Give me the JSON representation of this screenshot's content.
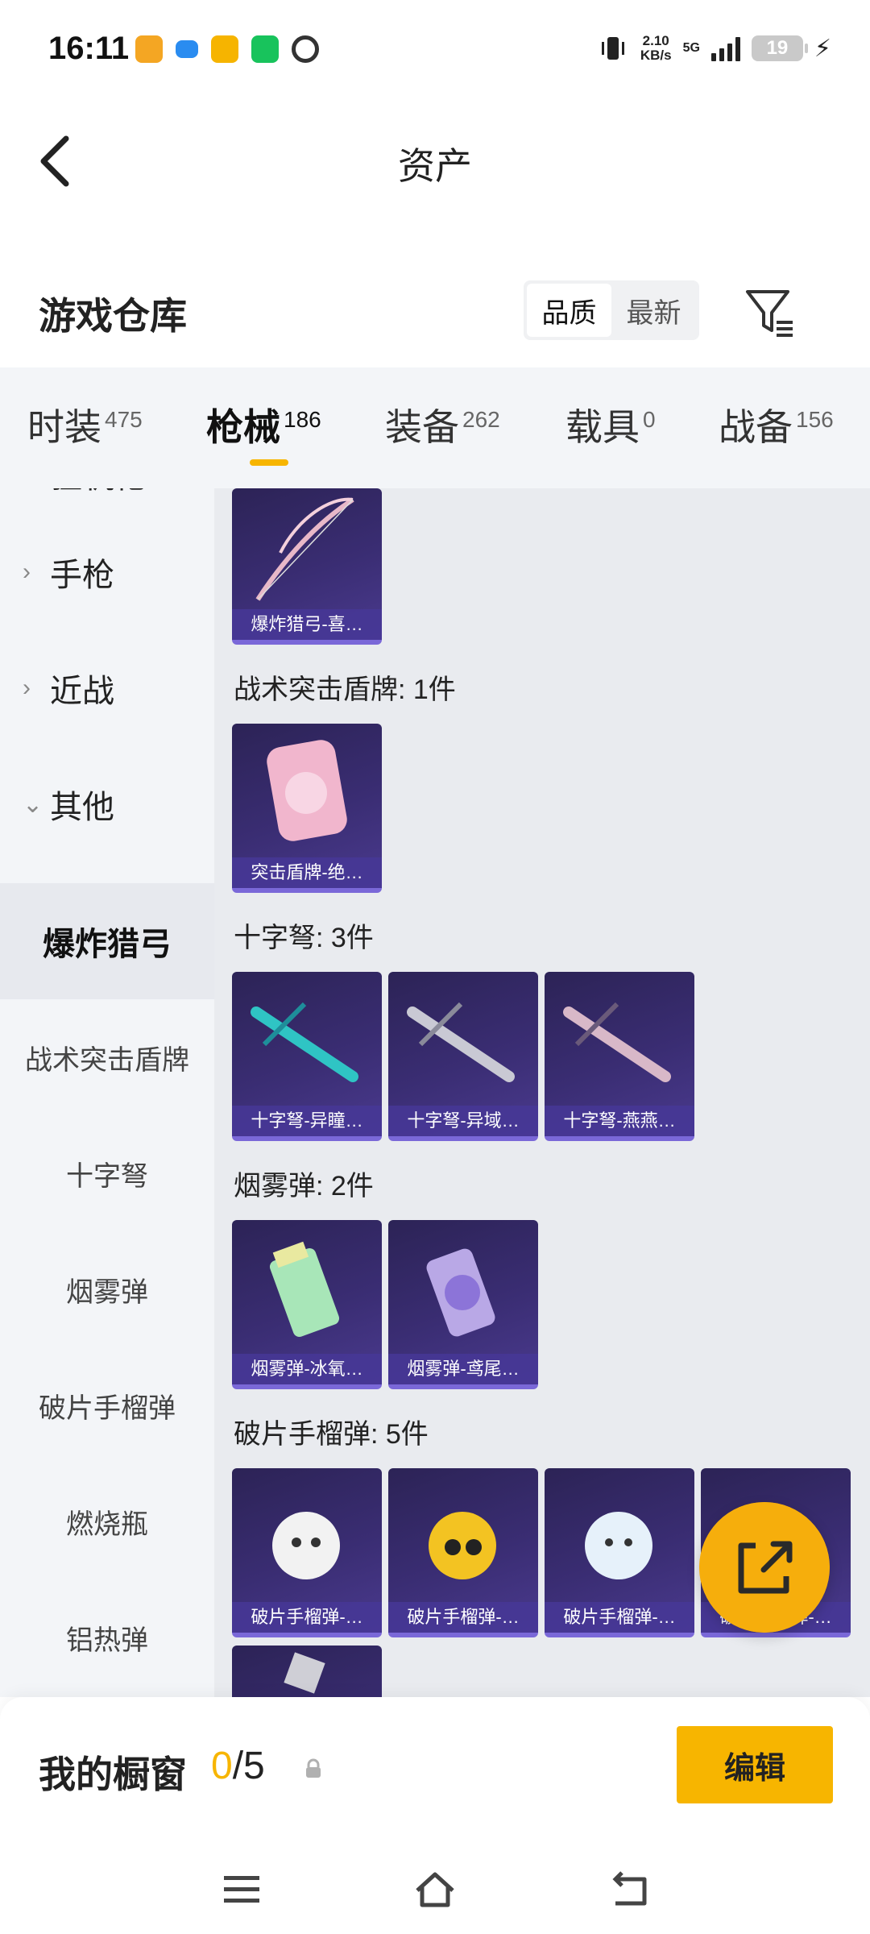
{
  "status_bar": {
    "time": "16:11",
    "net_speed": "2.10",
    "net_speed_unit": "KB/s",
    "network": "5G",
    "battery": "19"
  },
  "header": {
    "title": "资产"
  },
  "warehouse": {
    "title": "游戏仓库",
    "sort_options": [
      "品质",
      "最新"
    ],
    "active_sort": "品质"
  },
  "tabs": [
    {
      "label": "时装",
      "count": "475"
    },
    {
      "label": "枪械",
      "count": "186"
    },
    {
      "label": "装备",
      "count": "262"
    },
    {
      "label": "载具",
      "count": "0"
    },
    {
      "label": "战备",
      "count": "156"
    }
  ],
  "sidebar": {
    "groups": [
      "狙机枪",
      "手枪",
      "近战",
      "其他"
    ],
    "subs": [
      "爆炸猎弓",
      "战术突击盾牌",
      "十字弩",
      "烟雾弹",
      "破片手榴弹",
      "燃烧瓶",
      "铝热弹"
    ]
  },
  "sections": {
    "bow_card": "爆炸猎弓-喜…",
    "shield_title": "战术突击盾牌: 1件",
    "shield_card": "突击盾牌-绝…",
    "crossbow_title": "十字弩: 3件",
    "crossbow_cards": [
      "十字弩-异瞳…",
      "十字弩-异域…",
      "十字弩-燕燕…"
    ],
    "smoke_title": "烟雾弹: 2件",
    "smoke_cards": [
      "烟雾弹-冰氧…",
      "烟雾弹-鸢尾…"
    ],
    "frag_title": "破片手榴弹: 5件",
    "frag_cards": [
      "破片手榴弹-…",
      "破片手榴弹-…",
      "破片手榴弹-…",
      "破片手榴弹-…"
    ]
  },
  "bottom": {
    "window_title": "我的橱窗",
    "window_current": "0",
    "window_total": "/5",
    "edit_label": "编辑"
  },
  "colors": {
    "accent": "#f7b500",
    "card_bg": "#3a2d73",
    "panel_bg": "#f3f5f8"
  }
}
